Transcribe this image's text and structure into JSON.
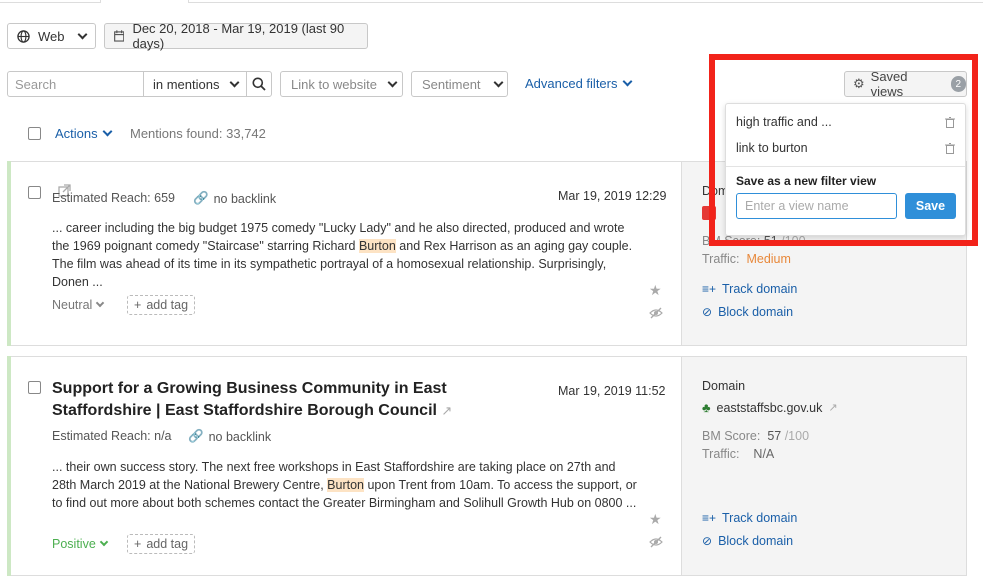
{
  "toolbar": {
    "source_label": "Web",
    "date_range": "Dec 20, 2018 - Mar 19, 2019 (last 90 days)",
    "search_placeholder": "Search",
    "search_scope": "in mentions",
    "link_to_website": "Link to website",
    "sentiment": "Sentiment",
    "advanced_filters": "Advanced filters",
    "saved_views_label": "Saved views",
    "saved_views_count": "2"
  },
  "list_header": {
    "actions_label": "Actions",
    "mentions_found": "Mentions found: 33,742"
  },
  "saved_views_popup": {
    "views": [
      {
        "name": "high traffic and ..."
      },
      {
        "name": "link to burton"
      }
    ],
    "save_heading": "Save as a new filter view",
    "name_placeholder": "Enter a view name",
    "save_button": "Save"
  },
  "mentions": [
    {
      "reach": "Estimated Reach: 659",
      "backlink": "no backlink",
      "date": "Mar 19, 2019 12:29",
      "snippet_pre": "... career including the big budget 1975 comedy \"Lucky Lady\" and he also directed, produced and wrote the 1969 poignant comedy \"Staircase\" starring Richard ",
      "snippet_hl": "Burton",
      "snippet_post": " and Rex Harrison as an aging gay couple. The film was ahead of its time in its sympathetic portrayal of a homosexual relationship. Surprisingly, Donen ...",
      "sentiment": "Neutral",
      "add_tag": "add tag",
      "side": {
        "domain_label": "Dom",
        "bm_score_label": "BM Score:",
        "bm_score": "51",
        "bm_score_max": "/100",
        "traffic_label": "Traffic:",
        "traffic": "Medium",
        "track_domain": "Track domain",
        "block_domain": "Block domain"
      }
    },
    {
      "title": "Support for a Growing Business Community in East Staffordshire | East Staffordshire Borough Council",
      "reach": "Estimated Reach: n/a",
      "backlink": "no backlink",
      "date": "Mar 19, 2019 11:52",
      "snippet_pre": "... their own success story. The next free workshops in East Staffordshire are taking place on 27th and 28th March 2019 at the National Brewery Centre, ",
      "snippet_hl": "Burton",
      "snippet_post": " upon Trent from 10am. To access the support, or to find out more about both schemes contact the Greater Birmingham and Solihull Growth Hub on 0800 ...",
      "sentiment": "Positive",
      "add_tag": "add tag",
      "side": {
        "domain_label": "Domain",
        "domain": "eaststaffsbc.gov.uk",
        "bm_score_label": "BM Score:",
        "bm_score": "57",
        "bm_score_max": "/100",
        "traffic_label": "Traffic:",
        "traffic": "N/A",
        "track_domain": "Track domain",
        "block_domain": "Block domain"
      }
    }
  ],
  "colors": {
    "accent_link": "#1a5fa8",
    "save_button": "#2f8fd9",
    "highlight_box": "#f2231a",
    "traffic_medium": "#e8883a",
    "positive": "#4caf50"
  }
}
